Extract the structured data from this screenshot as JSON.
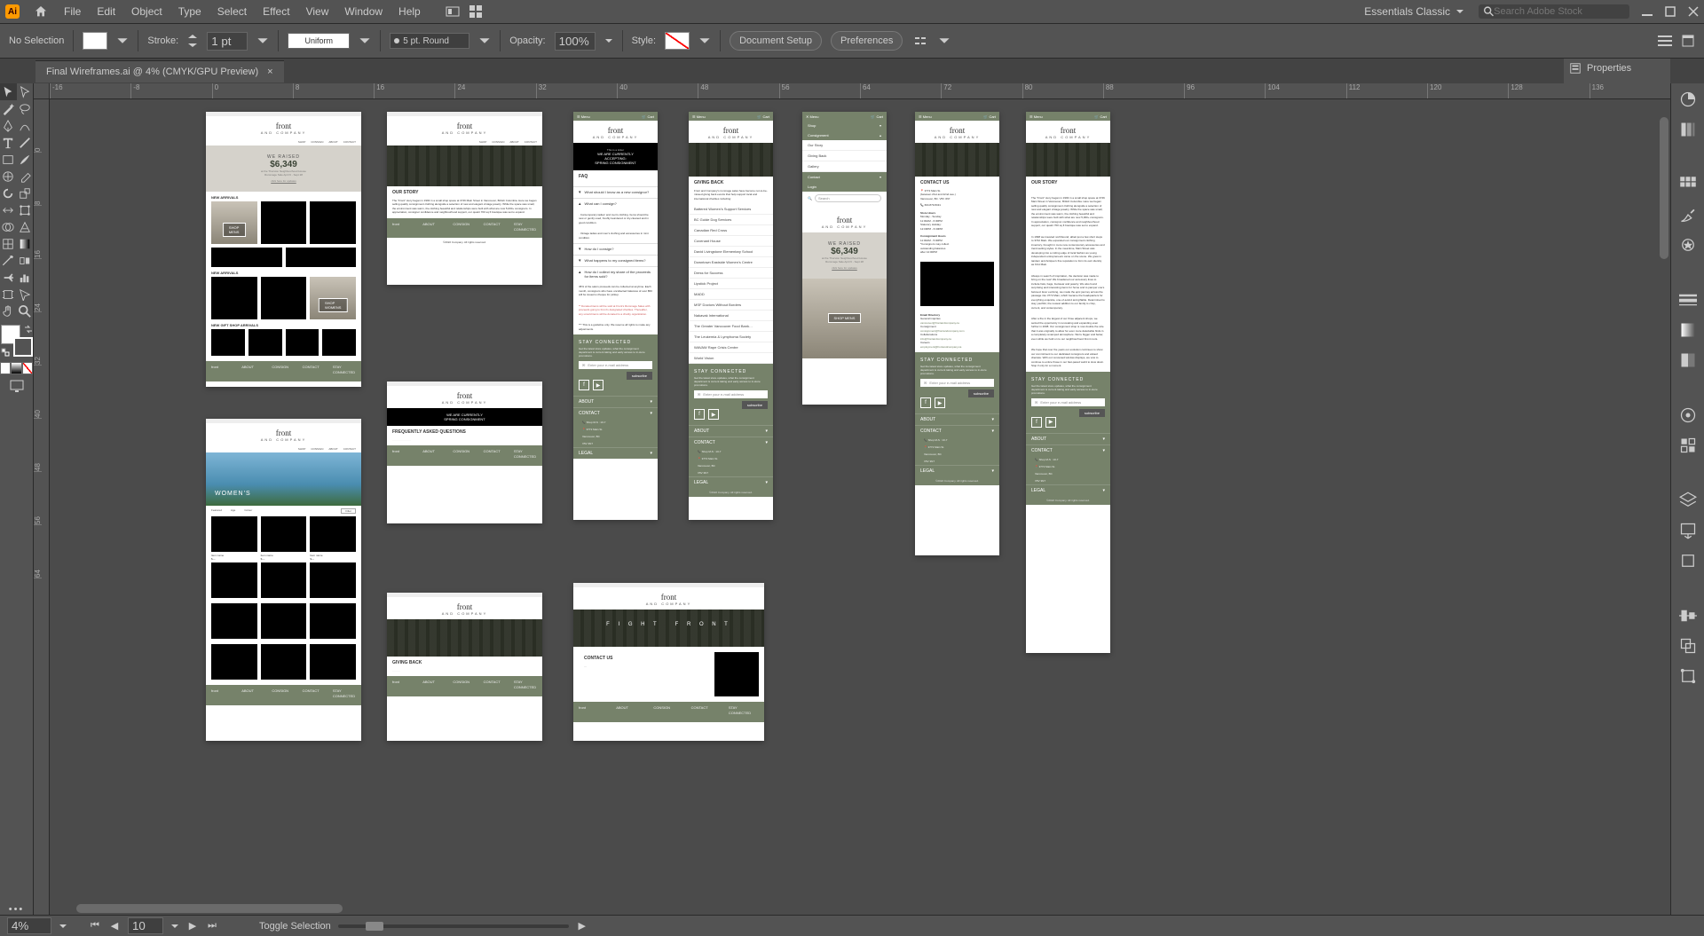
{
  "app": {
    "workspace": "Essentials Classic",
    "search_placeholder": "Search Adobe Stock"
  },
  "menu": [
    "File",
    "Edit",
    "Object",
    "Type",
    "Select",
    "Effect",
    "View",
    "Window",
    "Help"
  ],
  "control": {
    "selection_label": "No Selection",
    "stroke_label": "Stroke:",
    "stroke_weight": "1 pt",
    "stroke_profile": "Uniform",
    "brush_label": "5 pt. Round",
    "opacity_label": "Opacity:",
    "opacity_value": "100%",
    "style_label": "Style:",
    "doc_setup": "Document Setup",
    "preferences": "Preferences"
  },
  "doc": {
    "tab": "Final Wireframes.ai @ 4% (CMYK/GPU Preview)"
  },
  "panels": {
    "properties": "Properties",
    "libraries": "Libraries",
    "layers": "Layers"
  },
  "ruler_h": [
    "-16",
    "-8",
    "0",
    "8",
    "16",
    "24",
    "32",
    "40",
    "48",
    "56",
    "64",
    "72",
    "80",
    "88",
    "96",
    "104",
    "112",
    "120",
    "128",
    "136"
  ],
  "ruler_v": [
    "0",
    "8",
    "16",
    "24",
    "32",
    "40",
    "48",
    "56",
    "64"
  ],
  "status": {
    "zoom": "4%",
    "artboard": "10",
    "toggle": "Toggle Selection"
  },
  "wireframes": {
    "brand": {
      "name": "front",
      "tagline": "AND COMPANY"
    },
    "hero_raised": {
      "label": "WE RAISED",
      "amount": "$6,349",
      "sub1": "at the Thurston Neighbourhood House",
      "sub2": "Rummage Sale April 6 - Sept 28",
      "cta": "click here for updates"
    },
    "ticker": "This is a ticker",
    "accepting": {
      "l1": "WE ARE CURRENTLY",
      "l2": "ACCEPTING:",
      "l3": "SPRING CONSIGNMENT"
    },
    "sections": {
      "new_arrivals": "NEW ARRIVALS",
      "gift_shop": "NEW GIFT SHOP ARRIVALS",
      "shop_mens": "SHOP MENS",
      "shop_womens": "SHOP WOMENS",
      "womens": "WOMEN'S"
    },
    "nav_desktop": [
      "SHOP",
      "CONSIGN",
      "ABOUT",
      "CONTACT"
    ],
    "mobile_top": {
      "menu": "Menu",
      "cart": "Cart"
    },
    "mobile_menu": {
      "shop": "Shop",
      "consignment": "Consignment",
      "our_story": "Our Story",
      "giving_back": "Giving Back",
      "gallery": "Gallery",
      "contact": "Contact",
      "login": "Login",
      "search": "Search"
    },
    "faq": {
      "title": "FAQ",
      "q1": "What should I know as a new consignor?",
      "q2": "What can I consign?",
      "a2a": "· Contemporary ladies' and men's clothing. Items should be new or gently used, freshly laundered or dry-cleaned and in good condition.",
      "a2b": "· Vintage ladies and men's clothing and accessories in mint condition.",
      "q3": "How do I consign?",
      "q4": "What happens to my consigned items?",
      "q5": "How do I collect my share of the proceeds for items sold?",
      "a5a": "45% of the sale's proceeds can be collected at anytime. Each month, consignors who have uncollected balances of over $50 will be issued a cheque for pickup.",
      "a5b": "** Donated items will be sold at Front's Rummage Sales with proceeds going to Front's designated charities. Thereafter, any unsold items will be donated to a charity organization.",
      "a5c": "*** This is a guideline only. We reserve all rights to make any adjustments."
    },
    "giving_back": {
      "title": "GIVING BACK",
      "intro": "Front and Company's rummage sales have become not-to-be-missed giving back events that help support local and international charities including:",
      "orgs": [
        "Battered Women's Support Services",
        "BC Guide Dog Services",
        "Canadian Red Cross",
        "Covenant House",
        "David Livingstone Elementary School",
        "Downtown Eastside Women's Centre",
        "Dress for Success",
        "Lipstick Project",
        "MADD",
        "MSF Doctors Without Borders",
        "Nakavak International",
        "The Greater Vancouver Food Bank…",
        "The Leukemia & Lymphoma Society",
        "WAVAW Rape Crisis Centre",
        "World Vision"
      ]
    },
    "contact": {
      "title": "CONTACT US",
      "address": [
        "3772 Main St.",
        "(between 21st and 22nd ave.)",
        "Vancouver, BC. V5V 3N7"
      ],
      "phone": "604.879.8431",
      "store_hours_hd": "Store Hours",
      "store_hours": [
        "Monday - Sunday",
        "11:00AM - 6:30PM",
        "Statutory Holiday:",
        "12:00PM - 6:30PM"
      ],
      "consign_hours_hd": "Consignment Hours",
      "consign_hours": [
        "11:00AM - 5:00PM",
        "*Consignors may collect",
        "outstanding balances",
        "after 12:00PM"
      ],
      "email_dir_hd": "Email Directory",
      "emails": [
        "General inquiries",
        "vancouver@frontandcompany.ca",
        "Consignment",
        "consignment@frontandcompany.com",
        "Collaborations",
        "info@frontandcompany.ca",
        "Careers",
        "employment@frontandcompany.ca"
      ]
    },
    "our_story": {
      "title": "OUR STORY",
      "p1": "The \"Front\" story began in 1993 in a small shop space at 3746 Main Street in Vancouver, British Columbia. Here we began selling quality consignment clothing alongside a selection of new and elegant vintage jewelry. While the space was small, the environment was warm, the clothing beautiful and relationships were built with what are now 5,000+ consignors. In appreciation, consignor confidence and neighbourhood support, our quaint 700 sq ft boutique was set to expand.",
      "p2": "In 1998 we traveled northbound, albeit just a few short steps to 3742 Main. We expanded our consignment clothing inventory, brought in more new contemporary accessories and trend-setting styles. In the meantime, Main Street was developing into a cutting edge of local fashion as young independent entrepreneurs came on the scene. We grew in tandem and Antique's fine reputation to form its own identity as First Main.",
      "p3": "Always in search of inspiration, the decision was made to bring on the new! We broadened our accessory lines to include hats, bags, footwear and jewelry. We also found surprising and interesting items for home and to pamper one's beloved. Ever evolving, we made the epic journey across the passage into 3772 Main, which became the headquarters for everything exquisite, one-of-a-kind and giftable. Determined to stay youthful, the newest addition to our family is crisp, current, and contemporary.",
      "p4": "After a fire in the largest of our three adjacent shops, we seized the opportunity in renovating and expanding even further in 2008. Our consignment shop is now double the size that it was originally to allow for even more delectable finds in a completely revamped atmosphere. We're bigger and better, even while we hold on to our neighbourhood Front roots.",
      "p5": "We hope that over the years our evolution continues to show our commitment to our dedicated consignors and valued clientele. With our renowned window displays, we vow to continue to entice those in our fast-paced world to slow down. Stop if only for a moment."
    },
    "about_page": {
      "heading": "OUR STORY",
      "faq_heading": "FREQUENTLY ASKED QUESTIONS"
    },
    "contact_page": {
      "heading": "CONTACT US",
      "giving_back": "GIVING BACK"
    },
    "stay": {
      "title": "STAY CONNECTED",
      "desc": "Get the latest store updates, what the consignment department is current taking and early access to in-store promotions.",
      "placeholder": "Enter your e-mail address",
      "button": "subscribe"
    },
    "footer": {
      "about": "ABOUT",
      "contact": "CONTACT",
      "legal": "LEGAL",
      "hours": "Shop M-S : 10-7",
      "addr": [
        "3772 Main St.",
        "Vancouver, BC",
        "V5V 3N7"
      ],
      "copyright": "©2022 Company. All rights reserved.",
      "cols": {
        "front": "front",
        "about": "ABOUT",
        "consign": "CONSIGN",
        "contact": "CONTACT",
        "stay": "STAY CONNECTED"
      }
    },
    "category_filters": [
      "Featured",
      "Age",
      "Colour",
      "Filter"
    ]
  }
}
